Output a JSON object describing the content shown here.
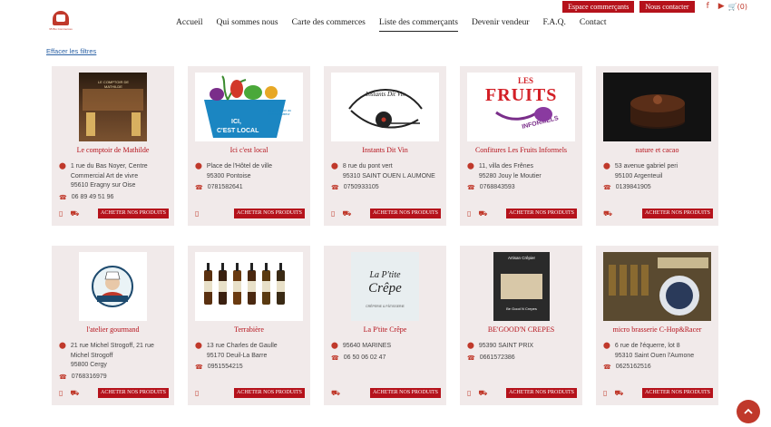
{
  "top": {
    "btn1": "Espace commerçants",
    "btn2": "Nous contacter",
    "cart": "(0)"
  },
  "logo": {
    "text": "95 Bio Commerces"
  },
  "nav": [
    "Accueil",
    "Qui sommes nous",
    "Carte des commerces",
    "Liste des commerçants",
    "Devenir vendeur",
    "F.A.Q.",
    "Contact"
  ],
  "clear_filters": "Effacer les filtres",
  "buy_label": "ACHETER NOS PRODUITS",
  "cards": [
    {
      "name": "Le comptoir de Mathilde",
      "addr": [
        "1 rue du Bas Noyer, Centre",
        "Commercial Art de vivre",
        "95610 Eragny sur Oise"
      ],
      "phone": "06 89 49 51 96",
      "icons": [
        "shop",
        "truck"
      ]
    },
    {
      "name": "Ici c'est local",
      "addr": [
        "Place de l'Hôtel de ville",
        "95300 Pontoise"
      ],
      "phone": "0781582641",
      "icons": [
        "shop"
      ]
    },
    {
      "name": "Instants Dit Vin",
      "addr": [
        "8 rue du pont vert",
        "95310 SAINT OUEN L AUMONE"
      ],
      "phone": "0750933105",
      "icons": [
        "shop",
        "truck"
      ]
    },
    {
      "name": "Confitures Les Fruits Informels",
      "addr": [
        "11, villa des Frênes",
        "95280 Jouy le Moutier"
      ],
      "phone": "0768843593",
      "icons": [
        "shop",
        "truck"
      ]
    },
    {
      "name": "nature et cacao",
      "addr": [
        "53 avenue gabriel peri",
        "95100 Argenteuil"
      ],
      "phone": "0139841905",
      "icons": [
        "truck"
      ]
    },
    {
      "name": "l'atelier gourmand",
      "addr": [
        "21 rue Michel Strogoff, 21 rue",
        "Michel Strogoff",
        "95800 Cergy"
      ],
      "phone": "0768316979",
      "icons": [
        "shop",
        "truck"
      ]
    },
    {
      "name": "Terrabière",
      "addr": [
        "13 rue Charles de Gaulle",
        "95170 Deuil-La Barre"
      ],
      "phone": "0951554215",
      "icons": [
        "shop"
      ]
    },
    {
      "name": "La P'tite Crêpe",
      "addr": [
        "95640 MARINES"
      ],
      "phone": "06 50 06 02 47",
      "icons": [
        "truck"
      ]
    },
    {
      "name": "BE'GOOD'N CREPES",
      "addr": [
        "95390 SAINT PRIX"
      ],
      "phone": "0661572386",
      "icons": [
        "shop",
        "truck"
      ]
    },
    {
      "name": "micro brasserie C-Hop&Racer",
      "addr": [
        "6 rue de l'équerre, lot 8",
        "95310 Saint Ouen l'Aumone"
      ],
      "phone": "0625162516",
      "icons": [
        "shop",
        "truck"
      ]
    }
  ],
  "image_texts": {
    "mathilde": "LE COMPTOIR DE MATHILDE",
    "local": "ICI, C'EST LOCAL",
    "local_sub": "de production au consommateur",
    "vin": "Instants Dit Vin",
    "fruits1": "LES",
    "fruits2": "FRUITS",
    "fruits3": "INFORMELS",
    "crepe1": "La P'tite",
    "crepe2": "Crêpe",
    "crepe_sub": "CRÊPERIE & PÂTISSERIE",
    "begood_title": "Artisan Crêpier",
    "begood_sub": "Be Good N Crepes"
  }
}
